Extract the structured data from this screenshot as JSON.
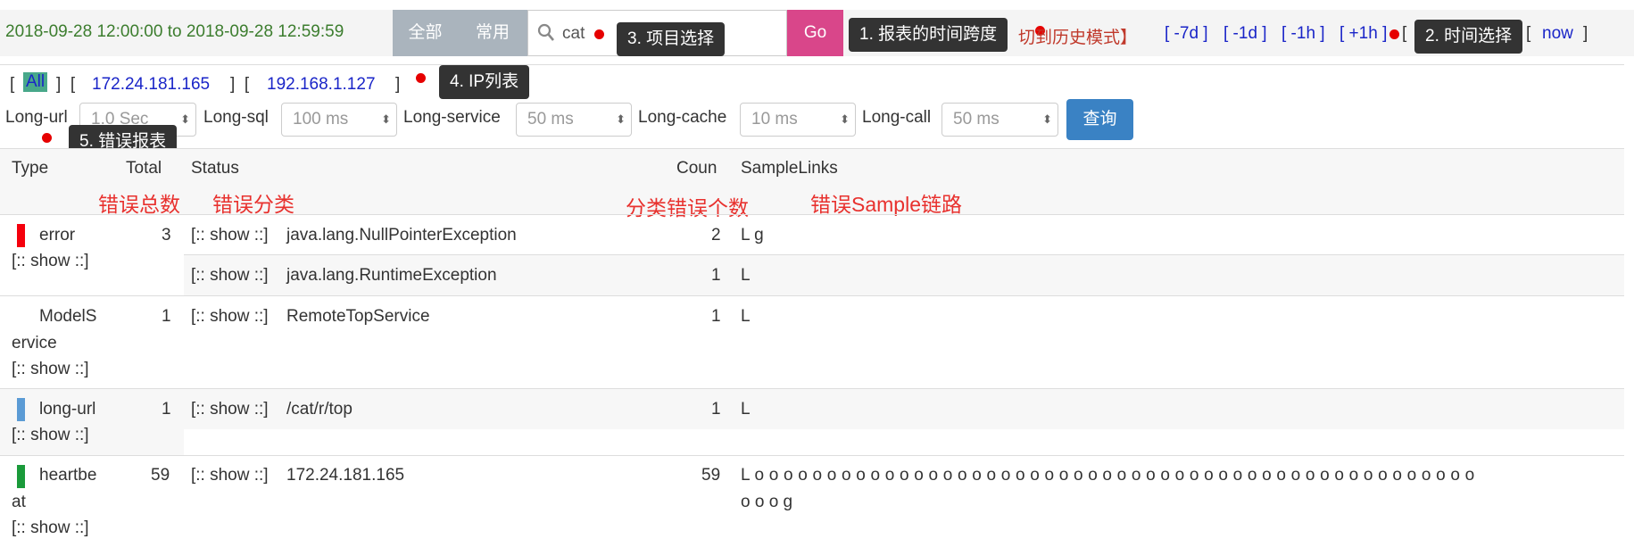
{
  "header": {
    "time_range": "2018-09-28 12:00:00 to 2018-09-28 12:59:59",
    "tab_all": "全部",
    "tab_common": "常用",
    "search_value": "cat",
    "go_label": "Go",
    "history_mode": "切到历史模式】",
    "nav": [
      "[ -7d ]",
      "[ -1d ]",
      "[ -1h ]",
      "[ +1h ]",
      "[",
      "]",
      "now ]"
    ],
    "now_prefix": "[",
    "now_label": "now"
  },
  "tooltips": {
    "t1": "1. 报表的时间跨度",
    "t2": "2. 时间选择",
    "t3": "3. 项目选择",
    "t4": "4. IP列表",
    "t5": "5. 错误报表"
  },
  "ip_list": {
    "open": "[",
    "all": "All",
    "items": [
      "172.24.181.165",
      "192.168.1.127"
    ]
  },
  "filters": [
    {
      "label": "Long-url",
      "value": "1.0 Sec"
    },
    {
      "label": "Long-sql",
      "value": "100 ms"
    },
    {
      "label": "Long-service",
      "value": "50 ms"
    },
    {
      "label": "Long-cache",
      "value": "10 ms"
    },
    {
      "label": "Long-call",
      "value": "50 ms"
    }
  ],
  "query_label": "查询",
  "table": {
    "headers": [
      "Type",
      "Total",
      "Status",
      "Coun",
      "SampleLinks"
    ],
    "annotations": [
      "错误总数",
      "错误分类",
      "分类错误个数",
      "错误Sample链路"
    ],
    "show": "[:: show ::]",
    "rows": [
      {
        "type": "error",
        "total": "3",
        "status": "java.lang.NullPointerException",
        "count": "2",
        "links": "L g"
      },
      {
        "status": "java.lang.RuntimeException",
        "count": "1",
        "links": "L"
      },
      {
        "type_l1": "ModelS",
        "type_l2": "ervice",
        "total": "1",
        "status": "RemoteTopService",
        "count": "1",
        "links": "L"
      },
      {
        "type": "long-url",
        "total": "1",
        "status": "/cat/r/top",
        "count": "1",
        "links": "L"
      },
      {
        "type_l1": "heartbe",
        "type_l2": "at",
        "total": "59",
        "status": "172.24.181.165",
        "count": "59",
        "links_l1": "L o o o o o o o o o o o o o o o o o o o o o o o o o o o o o o o o o o o o o o o o o o o o o o o o o o",
        "links_l2": "o o o g"
      }
    ]
  },
  "colors": {
    "error": "#f5000c",
    "long_url": "#5b9bd5",
    "heartbeat": "#1a9a3a"
  }
}
